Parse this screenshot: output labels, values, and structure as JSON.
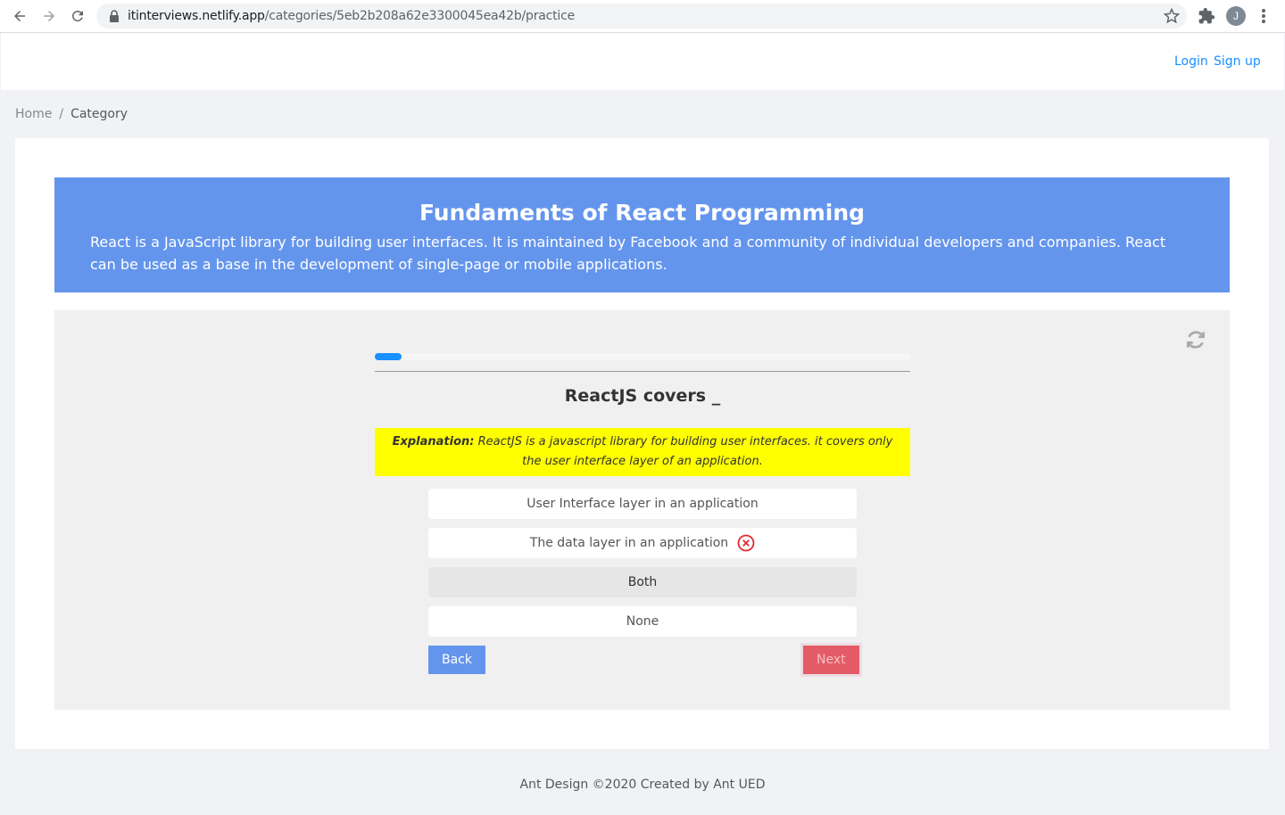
{
  "browser": {
    "url_host": "itinterviews.netlify.app",
    "url_path": "/categories/5eb2b208a62e3300045ea42b/practice",
    "profile_initial": "J"
  },
  "header": {
    "login_label": "Login",
    "signup_label": "Sign up"
  },
  "breadcrumb": {
    "home": "Home",
    "separator": "/",
    "current": "Category"
  },
  "banner": {
    "title": "Fundaments of React Programming",
    "description": "React is a JavaScript library for building user interfaces. It is maintained by Facebook and a community of individual developers and companies. React can be used as a base in the development of single-page or mobile applications."
  },
  "quiz": {
    "progress_percent": 5,
    "question": "ReactJS covers _",
    "explanation_label": "Explanation:",
    "explanation_text": "ReactJS is a javascript library for building user interfaces. it covers only the user interface layer of an application.",
    "options": [
      {
        "label": "User Interface layer in an application"
      },
      {
        "label": "The data layer in an application",
        "marked_wrong": true
      },
      {
        "label": "Both",
        "selected": true
      },
      {
        "label": "None"
      }
    ],
    "back_label": "Back",
    "next_label": "Next"
  },
  "footer": {
    "text": "Ant Design ©2020 Created by Ant UED"
  },
  "colors": {
    "banner": "#6495ed",
    "primary": "#1890ff",
    "explanation_bg": "#ffff00",
    "next_button": "#e35b66",
    "wrong_icon": "#e0282e"
  }
}
